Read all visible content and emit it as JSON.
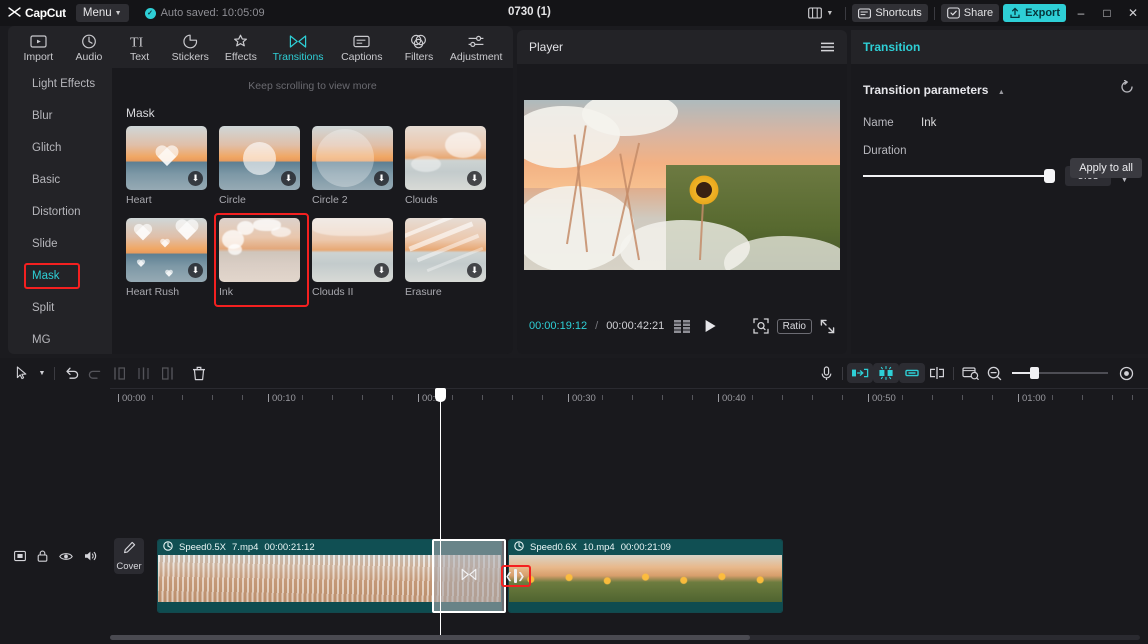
{
  "titlebar": {
    "brand": "CapCut",
    "menu_label": "Menu",
    "autosave_text": "Auto saved: 10:05:09",
    "project_title": "0730 (1)",
    "layout_icon": "layout-icon",
    "shortcuts_label": "Shortcuts",
    "share_label": "Share",
    "export_label": "Export",
    "minimize": "–",
    "maximize": "□",
    "close": "✕"
  },
  "toolbar": {
    "items": [
      {
        "label": "Import",
        "icon": "import-icon",
        "active": false
      },
      {
        "label": "Audio",
        "icon": "audio-icon",
        "active": false
      },
      {
        "label": "Text",
        "icon": "text-icon",
        "active": false
      },
      {
        "label": "Stickers",
        "icon": "stickers-icon",
        "active": false
      },
      {
        "label": "Effects",
        "icon": "effects-icon",
        "active": false
      },
      {
        "label": "Transitions",
        "icon": "transitions-icon",
        "active": true
      },
      {
        "label": "Captions",
        "icon": "captions-icon",
        "active": false
      },
      {
        "label": "Filters",
        "icon": "filters-icon",
        "active": false
      },
      {
        "label": "Adjustment",
        "icon": "adjustment-icon",
        "active": false
      }
    ]
  },
  "categories": {
    "items": [
      {
        "label": "Light Effects",
        "selected": false
      },
      {
        "label": "Blur",
        "selected": false
      },
      {
        "label": "Glitch",
        "selected": false
      },
      {
        "label": "Basic",
        "selected": false
      },
      {
        "label": "Distortion",
        "selected": false
      },
      {
        "label": "Slide",
        "selected": false
      },
      {
        "label": "Mask",
        "selected": true
      },
      {
        "label": "Split",
        "selected": false
      },
      {
        "label": "MG",
        "selected": false
      }
    ]
  },
  "grid": {
    "scroll_hint": "Keep scrolling to view more",
    "group_title": "Mask",
    "items": [
      {
        "name": "Heart",
        "downloadable": true,
        "selected": false
      },
      {
        "name": "Circle",
        "downloadable": true,
        "selected": false
      },
      {
        "name": "Circle 2",
        "downloadable": true,
        "selected": false
      },
      {
        "name": "Clouds",
        "downloadable": true,
        "selected": false
      },
      {
        "name": "Heart Rush",
        "downloadable": true,
        "selected": false
      },
      {
        "name": "Ink",
        "downloadable": false,
        "selected": true
      },
      {
        "name": "Clouds II",
        "downloadable": true,
        "selected": false
      },
      {
        "name": "Erasure",
        "downloadable": true,
        "selected": false
      }
    ]
  },
  "player": {
    "title": "Player",
    "menu_icon": "hamburger-icon",
    "current_time": "00:00:19:12",
    "time_separator": "/",
    "total_time": "00:00:42:21",
    "frames_icon": "frames-icon",
    "play_icon": "play-icon",
    "crop_icon": "crop-zoom-icon",
    "ratio_label": "Ratio",
    "fullscreen_icon": "fullscreen-icon"
  },
  "transition_panel": {
    "title": "Transition",
    "section_title": "Transition parameters",
    "collapse_icon": "chevron-up-icon",
    "reset_icon": "reset-icon",
    "name_label": "Name",
    "name_value": "Ink",
    "duration_label": "Duration",
    "duration_value": "5.0s",
    "duration_percent": 100,
    "apply_all_label": "Apply to all"
  },
  "timeline": {
    "tools_left": [
      {
        "icon": "cursor-icon",
        "dim": false
      },
      {
        "icon": "chevron-down-icon",
        "dim": false
      },
      {
        "icon": "undo-icon",
        "dim": false
      },
      {
        "icon": "redo-icon",
        "dim": true
      },
      {
        "icon": "split-left-icon",
        "dim": true
      },
      {
        "icon": "split-icon",
        "dim": true
      },
      {
        "icon": "split-right-icon",
        "dim": true
      },
      {
        "icon": "delete-icon",
        "dim": false
      }
    ],
    "tools_right": [
      {
        "icon": "microphone-icon",
        "active": false
      },
      {
        "icon": "snap-start-icon",
        "active": true
      },
      {
        "icon": "auto-cut-icon",
        "active": true
      },
      {
        "icon": "snap-end-icon",
        "active": true
      },
      {
        "icon": "split-marker-icon",
        "active": false
      },
      {
        "icon": "keyframe-icon",
        "active": false
      },
      {
        "icon": "zoom-out-icon",
        "active": false
      },
      {
        "icon": "zoom-in-icon",
        "active": false
      }
    ],
    "zoom_percent": 22,
    "ruler_ticks": [
      "00:00",
      "00:10",
      "00:20",
      "00:30",
      "00:40",
      "00:50",
      "01:00"
    ],
    "playhead_time": "00:19",
    "side_icons": [
      {
        "icon": "mirror-icon"
      },
      {
        "icon": "lock-icon"
      },
      {
        "icon": "eye-icon"
      },
      {
        "icon": "volume-icon"
      }
    ],
    "cover_label": "Cover",
    "cover_icon": "pencil-icon",
    "clips": [
      {
        "speed": "Speed0.5X",
        "file": "7.mp4",
        "duration": "00:00:21:12"
      },
      {
        "speed": "Speed0.6X",
        "file": "10.mp4",
        "duration": "00:00:21:09"
      }
    ],
    "transition_marker_icon": "bowtie-icon",
    "drag_handle_icon": "drag-handle-icon"
  },
  "colors": {
    "accent": "#2ecfd6",
    "highlight_red": "#f42020",
    "clip_teal": "#104f53",
    "panel_bg": "#19191d"
  }
}
